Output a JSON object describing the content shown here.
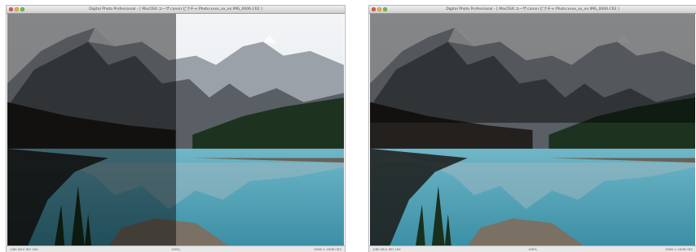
{
  "windows": [
    {
      "title": "Digital Photo Professional - [ MacOSX:ユーザ:canon:ピクチャ:Photo:xxxx_xx_xx:IMG_0006.CR2 ]",
      "status": {
        "left": "1/60  f/8.0  ISO 100",
        "center": "100%",
        "right": "3008 × 2008  CR2"
      },
      "overlay": {
        "type": "vertical-split",
        "dark_part": "left",
        "split_fraction": 0.5
      }
    },
    {
      "title": "Digital Photo Professional - [ MacOSX:ユーザ:canon:ピクチャ:Photo:xxxx_xx_xx:IMG_0006.CR2 ]",
      "status": {
        "left": "1/60  f/8.0  ISO 100",
        "center": "100%",
        "right": "3008 × 2008  CR2"
      },
      "overlay": {
        "type": "horizontal-split",
        "dark_part": "top",
        "split_fraction": 0.47
      }
    }
  ],
  "colors": {
    "sky": "#dfe5ec",
    "mountain_light": "#9aa1a8",
    "mountain_dark": "#4d5359",
    "forest": "#1d3320",
    "lake": "#3b8fa5",
    "rock": "#7b7064"
  }
}
